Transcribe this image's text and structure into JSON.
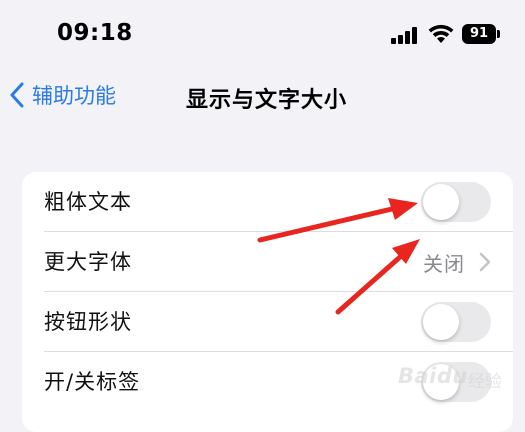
{
  "status_bar": {
    "time": "09:18",
    "battery_level": "91"
  },
  "nav": {
    "back_label": "辅助功能",
    "title": "显示与文字大小"
  },
  "settings": {
    "rows": [
      {
        "label": "粗体文本",
        "control": "toggle",
        "on": false
      },
      {
        "label": "更大字体",
        "control": "link",
        "value": "关闭"
      },
      {
        "label": "按钮形状",
        "control": "toggle",
        "on": false
      },
      {
        "label": "开/关标签",
        "control": "toggle",
        "on": false
      }
    ]
  },
  "annotations": {
    "arrow_color": "#e8251f"
  },
  "watermark": {
    "text": "Baidu",
    "sub": "经验"
  },
  "colors": {
    "background": "#f2f2f7",
    "accent": "#2a7be4",
    "toggle_off": "#e9e9eb"
  }
}
